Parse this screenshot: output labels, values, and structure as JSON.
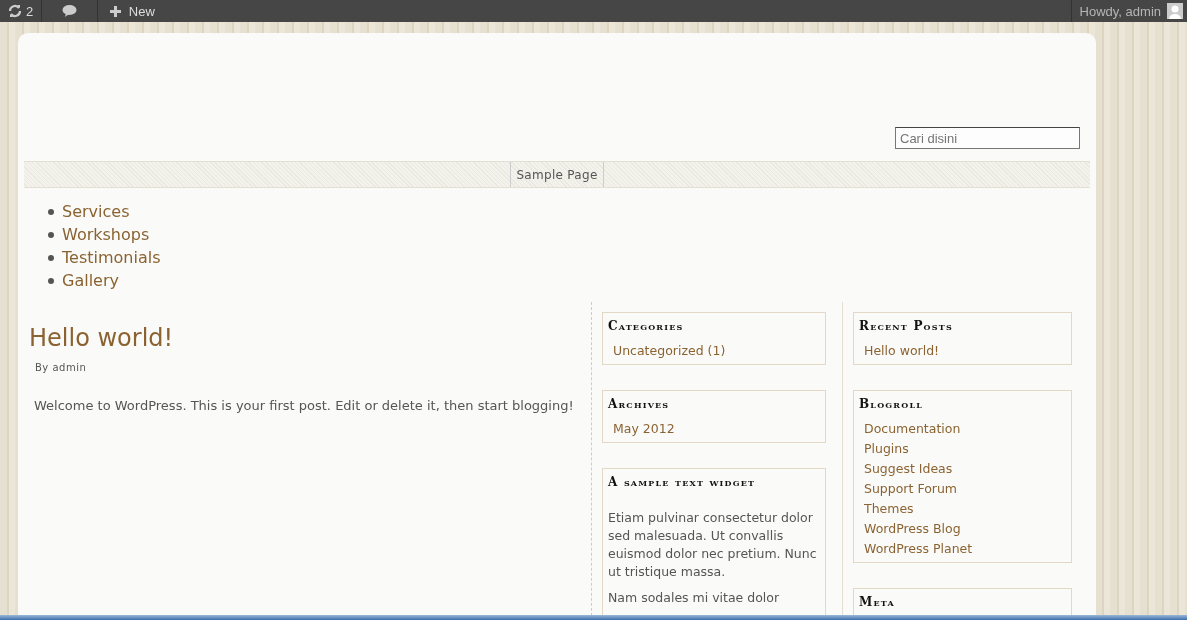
{
  "admin_bar": {
    "updates": "2",
    "new_label": "New",
    "greeting": "Howdy, admin"
  },
  "search": {
    "placeholder": "Cari disini"
  },
  "nav": [
    {
      "label": "Sample Page",
      "selected": false
    }
  ],
  "page_list": [
    "Services",
    "Workshops",
    "Testimonials",
    "Gallery"
  ],
  "post": {
    "title": "Hello world!",
    "byline": "By admin",
    "body": "Welcome to WordPress. This is your first post. Edit or delete it, then start blogging!"
  },
  "sidebar_1": [
    {
      "title": "Categories",
      "kind": "links",
      "links": [
        "Uncategorized (1)"
      ]
    },
    {
      "title": "Archives",
      "kind": "links",
      "links": [
        "May 2012"
      ]
    },
    {
      "title": "A sample text widget",
      "kind": "text",
      "paragraphs": [
        "Etiam pulvinar consectetur dolor sed malesuada. Ut convallis euismod dolor nec pretium. Nunc ut tristique massa.",
        "Nam sodales mi vitae dolor"
      ]
    }
  ],
  "sidebar_2": [
    {
      "title": "Recent Posts",
      "kind": "links",
      "links": [
        "Hello world!"
      ]
    },
    {
      "title": "Blogroll",
      "kind": "links",
      "links": [
        "Documentation",
        "Plugins",
        "Suggest Ideas",
        "Support Forum",
        "Themes",
        "WordPress Blog",
        "WordPress Planet"
      ]
    },
    {
      "title": "Meta",
      "kind": "links"
    }
  ]
}
